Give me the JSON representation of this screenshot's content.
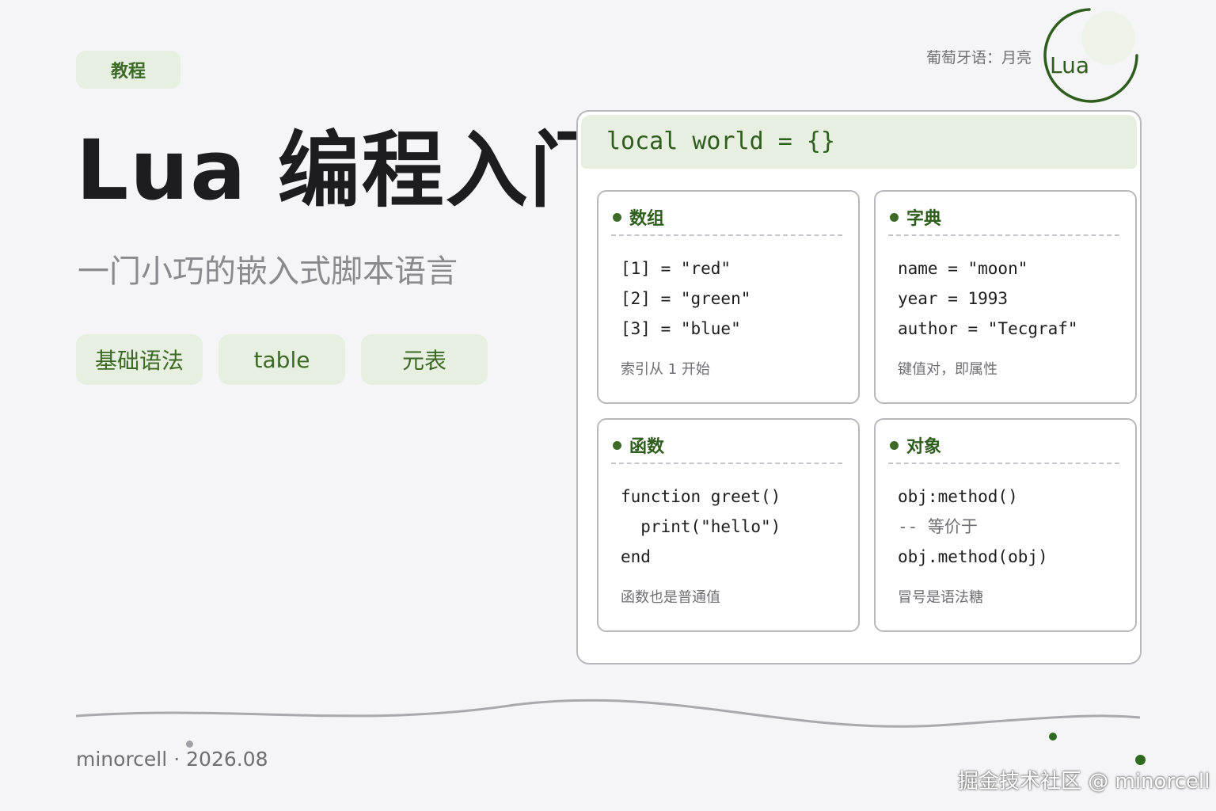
{
  "badge": "教程",
  "title": "Lua 编程入门",
  "subtitle": "一门小巧的嵌入式脚本语言",
  "chips": [
    "基础语法",
    "table",
    "元表"
  ],
  "logo": {
    "caption": "葡萄牙语：月亮",
    "text": "Lua",
    "color": "#2f5d1d"
  },
  "panel": {
    "header": "local world = {}",
    "cards": [
      {
        "title": "数组",
        "lines": [
          "[1] = \"red\"",
          "[2] = \"green\"",
          "[3] = \"blue\""
        ],
        "note": "索引从 1 开始"
      },
      {
        "title": "字典",
        "lines": [
          "name = \"moon\"",
          "year = 1993",
          "author = \"Tecgraf\""
        ],
        "note": "键值对，即属性"
      },
      {
        "title": "函数",
        "lines": [
          "function greet()",
          "  print(\"hello\")",
          "end"
        ],
        "note": "函数也是普通值"
      },
      {
        "title": "对象",
        "lines": [
          "obj:method()",
          "-- 等价于",
          "obj.method(obj)"
        ],
        "note": "冒号是语法糖"
      }
    ]
  },
  "footer": {
    "author": "minorcell",
    "separator": "·",
    "date": "2026.08"
  },
  "watermark": "掘金技术社区 @ minorcell",
  "colors": {
    "accent": "#3c6a26",
    "accent_bg": "#e6efe0",
    "background": "#f5f5f7"
  }
}
